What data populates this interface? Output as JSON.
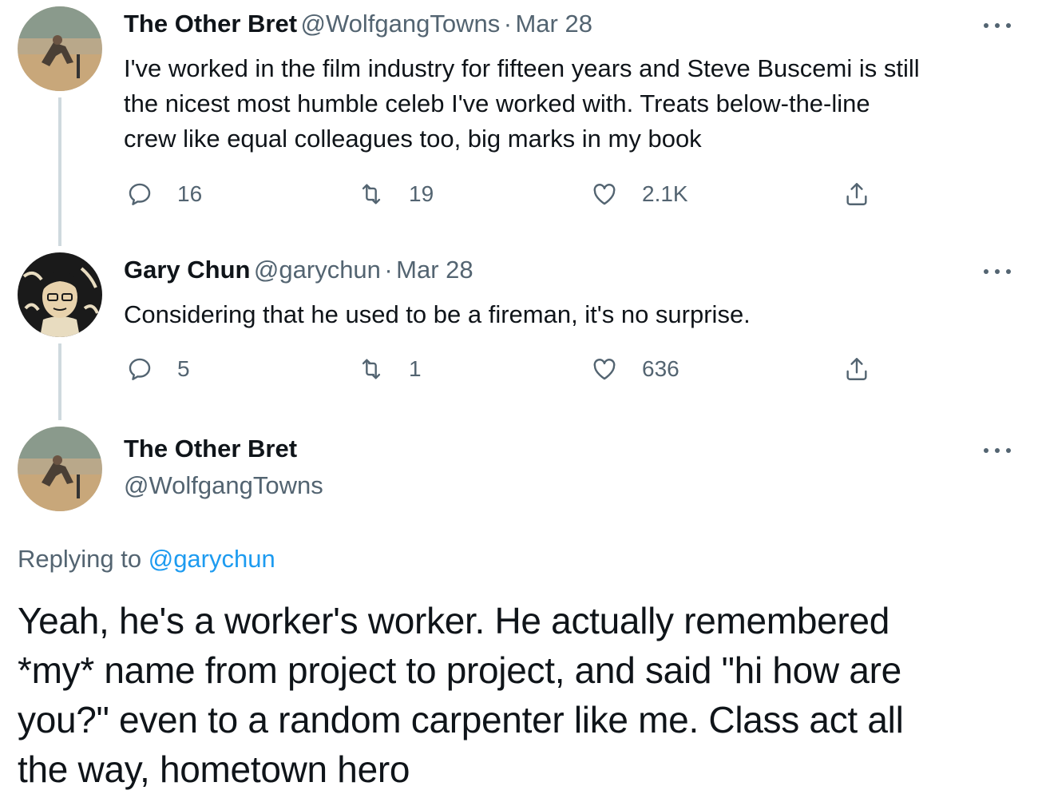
{
  "tweets": [
    {
      "name": "The Other Bret",
      "handle": "@WolfgangTowns",
      "sep": "·",
      "date": "Mar 28",
      "lines": [
        "I've worked in the film industry for fifteen years and Steve Buscemi is still",
        "the nicest most humble celeb I've worked with. Treats below-the-line",
        "crew like equal colleagues too, big marks in my book"
      ],
      "replies": "16",
      "retweets": "19",
      "likes": "2.1K"
    },
    {
      "name": "Gary Chun",
      "handle": "@garychun",
      "sep": "·",
      "date": "Mar 28",
      "lines": [
        "Considering that he used to be a fireman, it's no surprise."
      ],
      "replies": "5",
      "retweets": "1",
      "likes": "636"
    }
  ],
  "main_tweet": {
    "name": "The Other Bret",
    "handle": "@WolfgangTowns",
    "replying_prefix": "Replying to",
    "replying_handle": "@garychun",
    "lines": [
      "Yeah, he's a worker's worker. He actually remembered",
      "*my* name from project to project, and said \"hi how are",
      "you?\" even to a random carpenter like me. Class act all",
      "the way, hometown hero"
    ]
  },
  "icons": {
    "reply": "reply-icon",
    "retweet": "retweet-icon",
    "like": "heart-icon",
    "share": "share-icon",
    "more": "more-icon"
  },
  "colors": {
    "text": "#0f1419",
    "secondary": "#536471",
    "link": "#1d9bf0",
    "thread_line": "#cfd9de"
  }
}
